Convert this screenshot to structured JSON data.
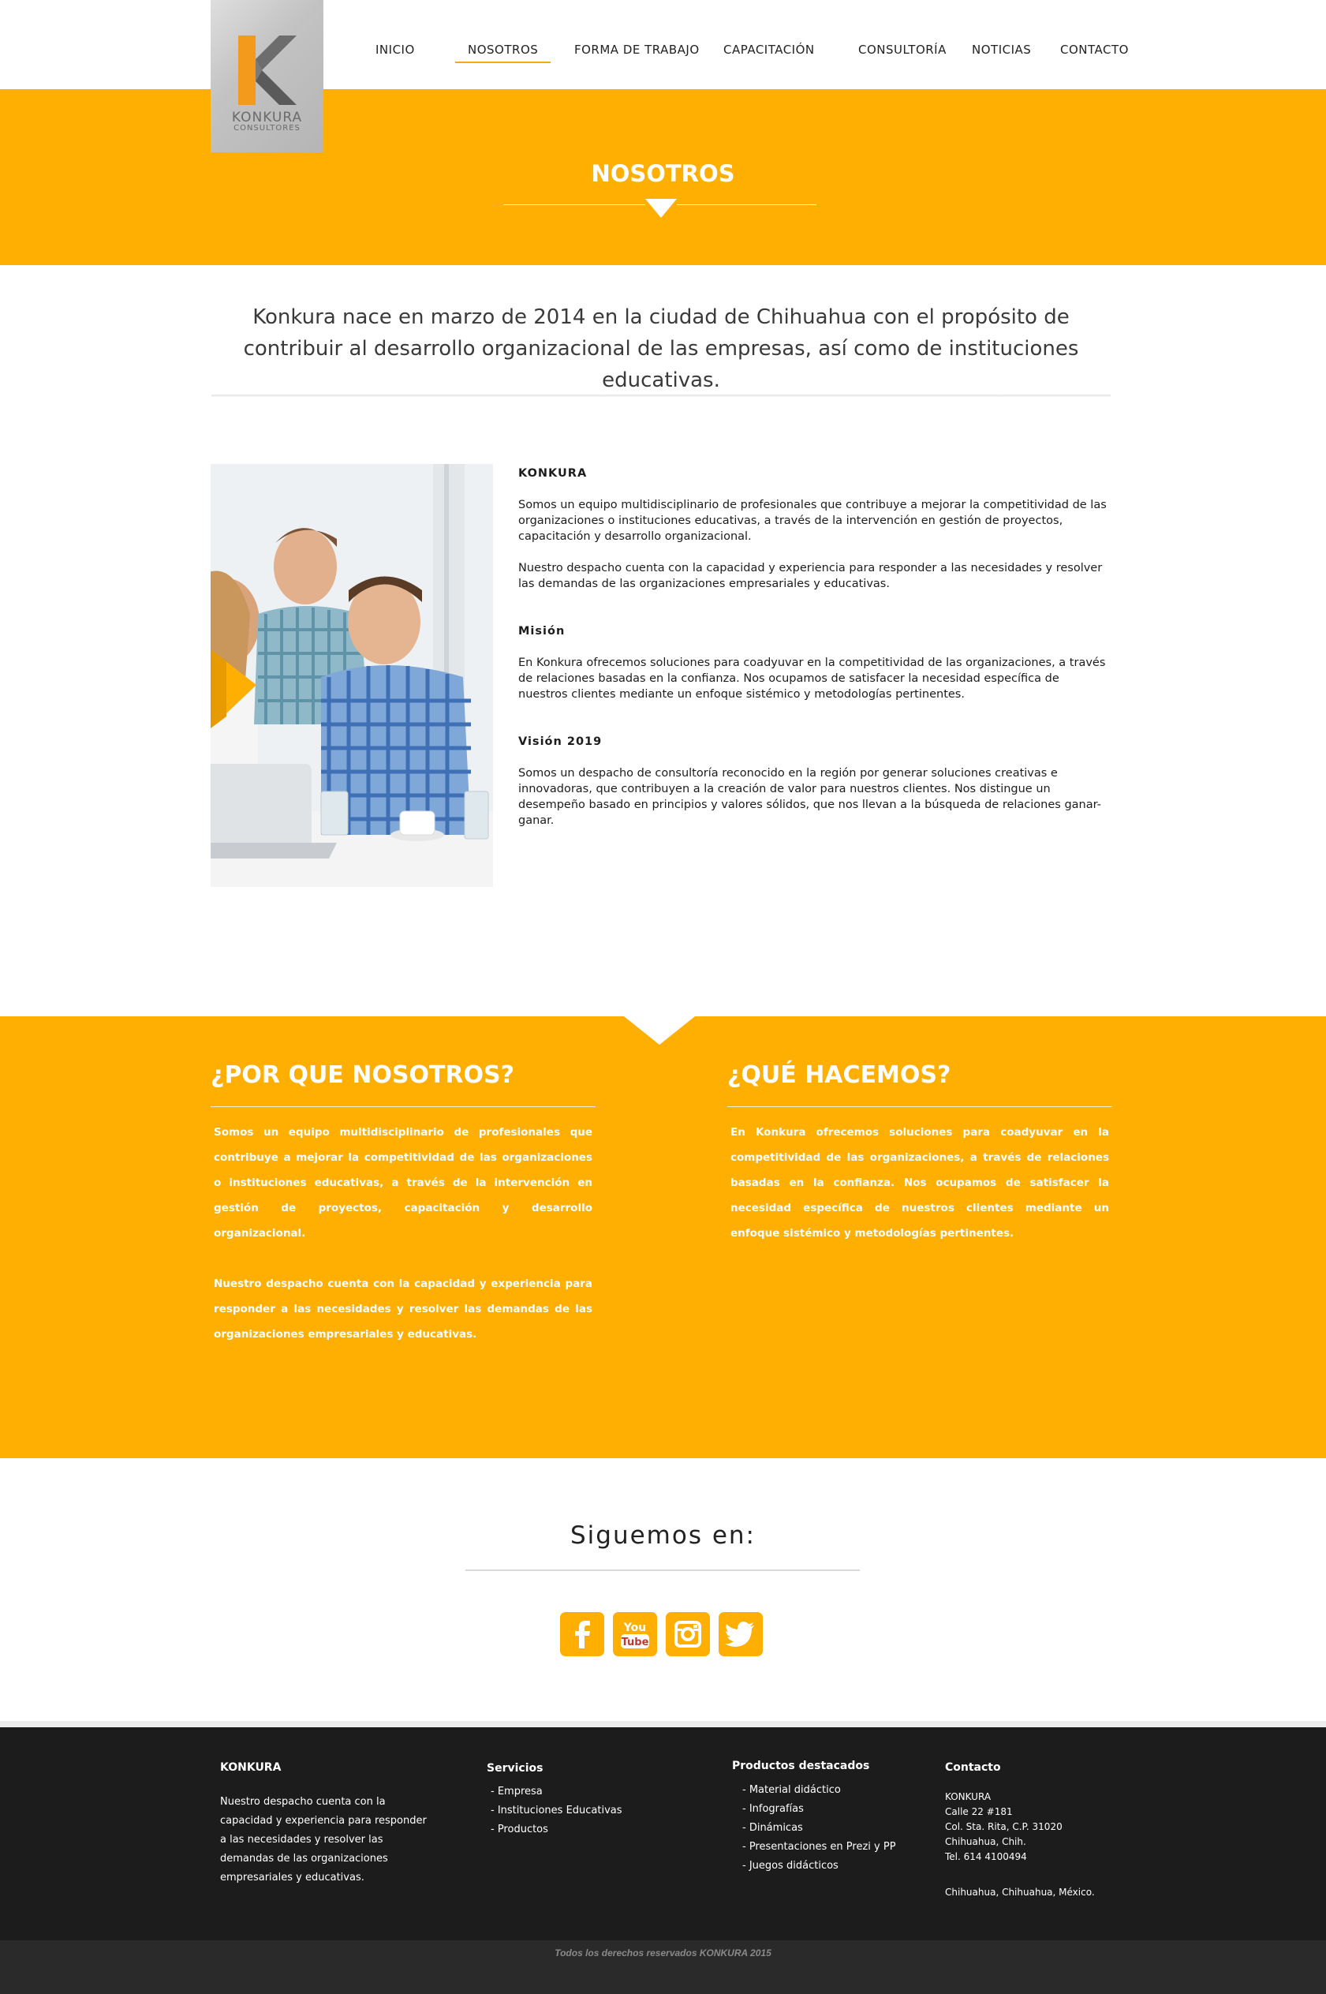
{
  "brand": {
    "logo_line1": "KONKURA",
    "logo_line2": "CONSULTORES"
  },
  "nav": {
    "items": [
      {
        "label": "INICIO"
      },
      {
        "label": "NOSOTROS"
      },
      {
        "label": "FORMA DE TRABAJO"
      },
      {
        "label": "CAPACITACIÓN"
      },
      {
        "label": "CONSULTORÍA"
      },
      {
        "label": "NOTICIAS"
      },
      {
        "label": "CONTACTO"
      }
    ],
    "active": "NOSOTROS"
  },
  "hero": {
    "title": "NOSOTROS"
  },
  "intro": {
    "text": "Konkura nace en marzo de 2014 en la ciudad de Chihuahua con el propósito de contribuir al desarrollo organizacional de las empresas, así como de instituciones educativas."
  },
  "about": {
    "heading": "KONKURA",
    "p1": "Somos un equipo multidisciplinario de profesionales que contribuye a mejorar la competitividad de las organizaciones o instituciones educativas, a través de la intervención en gestión de proyectos, capacitación y desarrollo organizacional.",
    "p2": "Nuestro despacho cuenta con la capacidad y experiencia  para responder a las necesidades y resolver las demandas de las organizaciones empresariales y educativas.",
    "mision_heading": "Misión",
    "mision_text": "En Konkura ofrecemos soluciones para coadyuvar en la competitividad de las organizaciones, a través de relaciones basadas en la confianza. Nos ocupamos  de satisfacer la necesidad específica de nuestros clientes mediante un enfoque sistémico y metodologías pertinentes.",
    "vision_heading": "Visión 2019",
    "vision_text": "Somos un despacho de consultoría reconocido en la región por generar soluciones creativas e innovadoras, que contribuyen a la creación de valor para nuestros clientes. Nos distingue un desempeño basado en principios y valores sólidos, que nos llevan a la búsqueda de relaciones ganar-ganar."
  },
  "why": {
    "title": "¿POR QUE NOSOTROS?",
    "p1": "Somos un equipo multidisciplinario de profesionales que contribuye a mejorar la competitividad de las organizaciones o instituciones educativas, a través de la intervención en gestión de proyectos, capacitación y desarrollo organizacional.",
    "p2": "Nuestro despacho cuenta con la capacidad y experiencia  para responder a las necesidades y resolver las demandas de las organizaciones empresariales y educativas."
  },
  "what": {
    "title": "¿QUÉ HACEMOS?",
    "p1": "En Konkura ofrecemos soluciones para coadyuvar en la competitividad de las organizaciones, a través de relaciones basadas en la confianza. Nos ocupamos  de satisfacer la necesidad específica de nuestros clientes mediante un enfoque sistémico y metodologías pertinentes."
  },
  "social": {
    "title": "Siguemos en:",
    "icons": [
      "facebook-icon",
      "youtube-icon",
      "instagram-icon",
      "twitter-icon"
    ],
    "youtube_line1": "You",
    "youtube_line2": "Tube"
  },
  "footer": {
    "col1": {
      "heading": "KONKURA",
      "text": "Nuestro despacho cuenta con la capacidad y experiencia  para responder a las necesidades y resolver las demandas de las organizaciones empresariales y educativas."
    },
    "col2": {
      "heading": "Servicios",
      "items": [
        "- Empresa",
        "-  Instituciones Educativas",
        "- Productos"
      ]
    },
    "col3": {
      "heading": "Productos destacados",
      "items": [
        "- Material didáctico",
        "- Infografías",
        "- Dinámicas",
        "- Presentaciones en Prezi y PP",
        "- Juegos didácticos"
      ]
    },
    "col4": {
      "heading": "Contacto",
      "lines": [
        "KONKURA",
        "Calle 22 #181",
        "Col. Sta. Rita, C.P. 31020",
        "Chihuahua, Chih.",
        "Tel. 614 4100494"
      ],
      "location": "Chihuahua, Chihuahua, México."
    },
    "copyright": "Todos los derechos reservados KONKURA 2015"
  },
  "colors": {
    "accent": "#feaf01",
    "logo_orange": "#f39a1d",
    "footer_bg": "#1c1c1c"
  }
}
